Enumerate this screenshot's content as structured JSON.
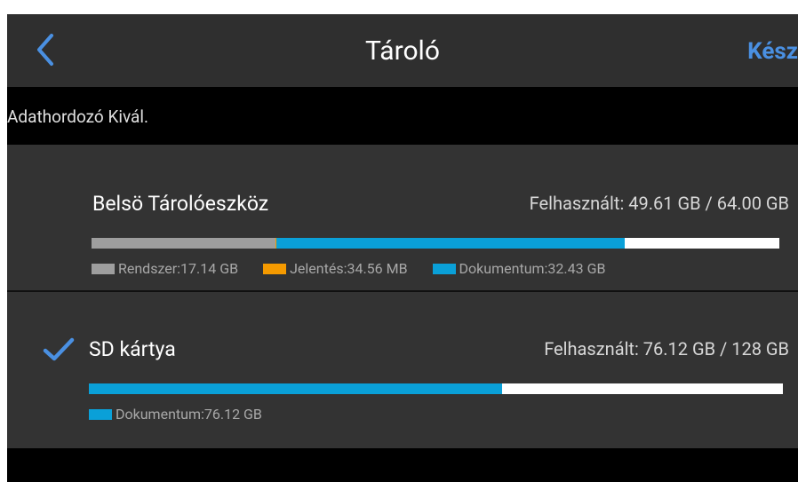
{
  "header": {
    "title": "Tároló",
    "done_label": "Kész",
    "back_icon": "chevron-left-icon"
  },
  "section_label": "Adathordozó Kivál.",
  "colors": {
    "accent": "#4a90e2",
    "system": "#9e9e9e",
    "report": "#f59a00",
    "documents": "#0aa0d8",
    "free": "#ffffff"
  },
  "storages": [
    {
      "name": "Belsö Tárolóeszköz",
      "usage_text": "Felhasznált: 49.61 GB / 64.00 GB",
      "selected": false,
      "usage_fractions": {
        "system": 0.268,
        "report": 0.0005,
        "documents": 0.507
      },
      "legend": [
        {
          "key": "system",
          "label": "Rendszer:17.14 GB"
        },
        {
          "key": "report",
          "label": "Jelentés:34.56 MB"
        },
        {
          "key": "documents",
          "label": "Dokumentum:32.43 GB"
        }
      ]
    },
    {
      "name": "SD kártya",
      "usage_text": "Felhasznált: 76.12 GB / 128 GB",
      "selected": true,
      "usage_fractions": {
        "documents": 0.595
      },
      "legend": [
        {
          "key": "documents",
          "label": "Dokumentum:76.12 GB"
        }
      ]
    }
  ]
}
